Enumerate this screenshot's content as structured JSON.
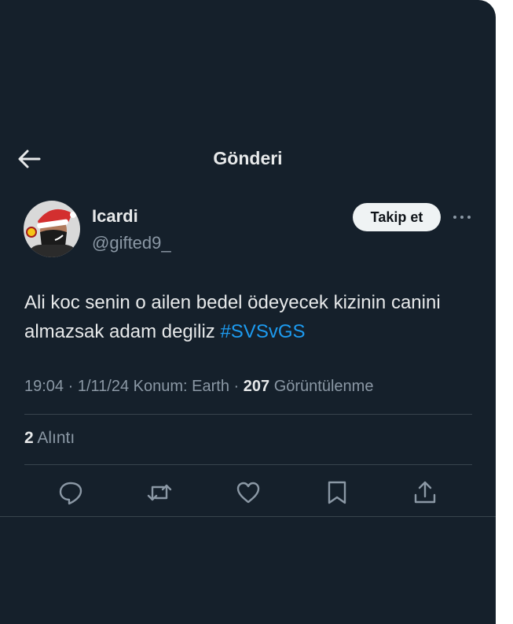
{
  "header": {
    "title": "Gönderi"
  },
  "author": {
    "name": "Icardi",
    "handle": "@gifted9_"
  },
  "follow_label": "Takip et",
  "tweet": {
    "text": "Ali koc senin o ailen bedel ödeyecek kizinin canini almazsak adam degiliz",
    "hashtag": "#SVSvGS"
  },
  "meta": {
    "time": "19:04",
    "date": "1/11/24",
    "location": "Konum: Earth",
    "views_count": "207",
    "views_label": "Görüntülenme",
    "separator": "·"
  },
  "quotes": {
    "count": "2",
    "label": "Alıntı"
  },
  "icons": {
    "back": "arrow-left-icon",
    "more": "more-horizontal-icon",
    "reply": "reply-icon",
    "retweet": "retweet-icon",
    "like": "heart-icon",
    "bookmark": "bookmark-icon",
    "share": "share-icon"
  },
  "colors": {
    "background": "#15202b",
    "text": "#e7e9ea",
    "secondary_text": "#8b98a5",
    "link": "#1d9bf0",
    "divider": "#38444d",
    "follow_button": "#eff3f4"
  }
}
